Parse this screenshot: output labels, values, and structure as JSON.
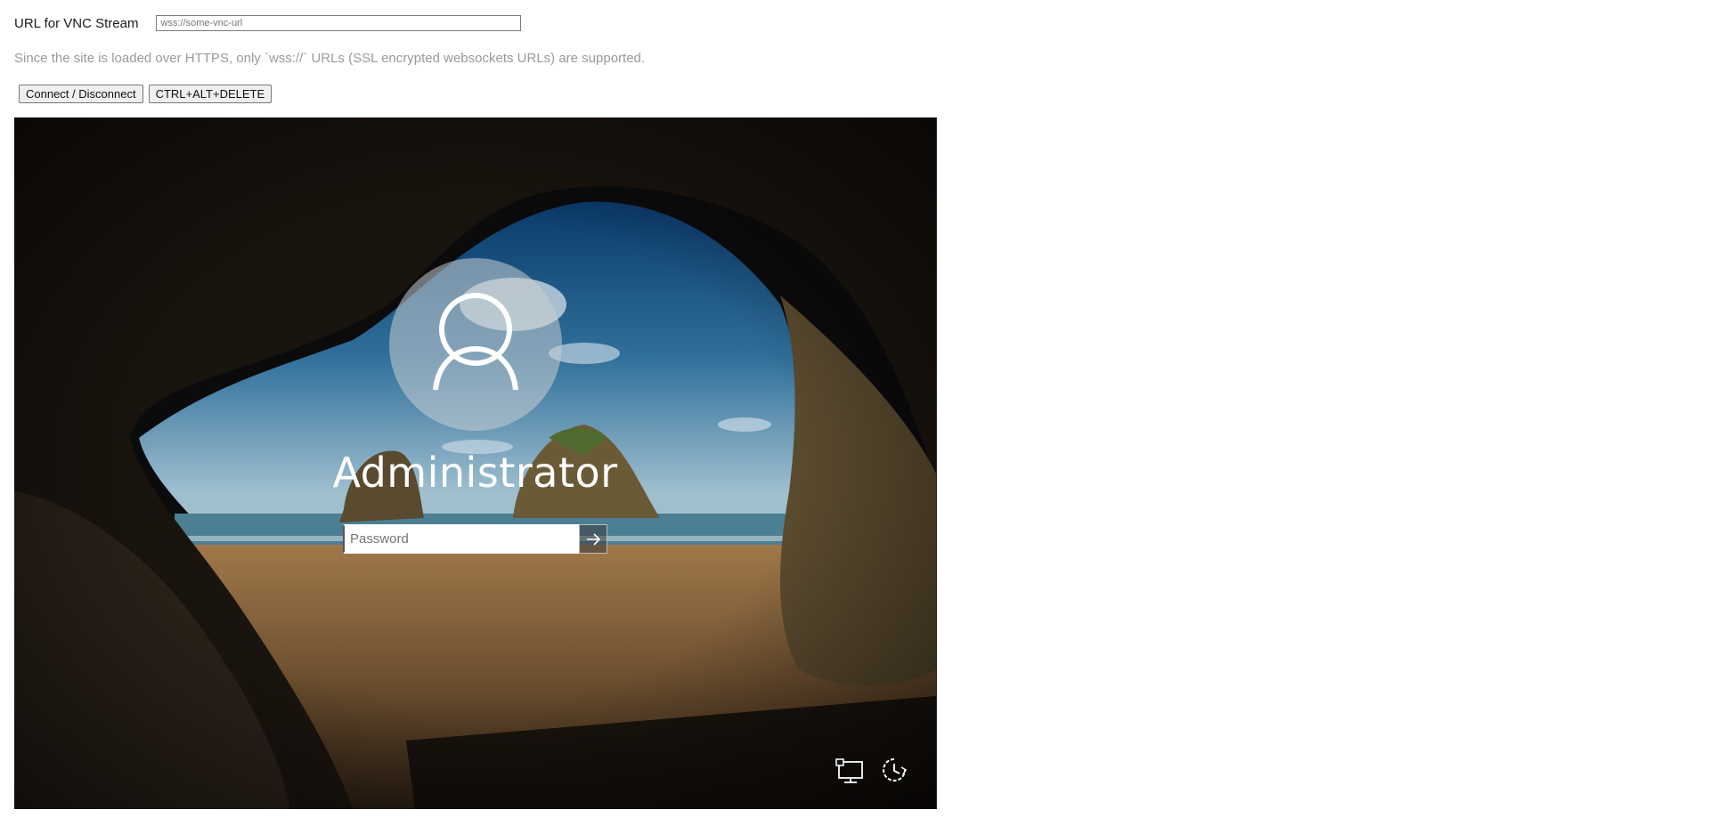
{
  "url_row": {
    "label": "URL for VNC Stream",
    "input_placeholder": "wss://some-vnc-url"
  },
  "note": "Since the site is loaded over HTTPS, only `wss://` URLs (SSL encrypted websockets URLs) are supported.",
  "buttons": {
    "connect_label": "Connect / Disconnect",
    "ctrl_alt_del_label": "CTRL+ALT+DELETE"
  },
  "vnc_screen": {
    "lock_screen": {
      "username": "Administrator",
      "password_placeholder": "Password",
      "submit_icon": "arrow-right-icon",
      "avatar_icon": "user-silhouette-icon"
    },
    "bottom_icons": [
      "network-icon",
      "ease-of-access-power-icon"
    ]
  },
  "colors": {
    "page_background": "#ffffff",
    "note_text": "#9a9a9a",
    "lockscreen_text": "#ffffff"
  }
}
